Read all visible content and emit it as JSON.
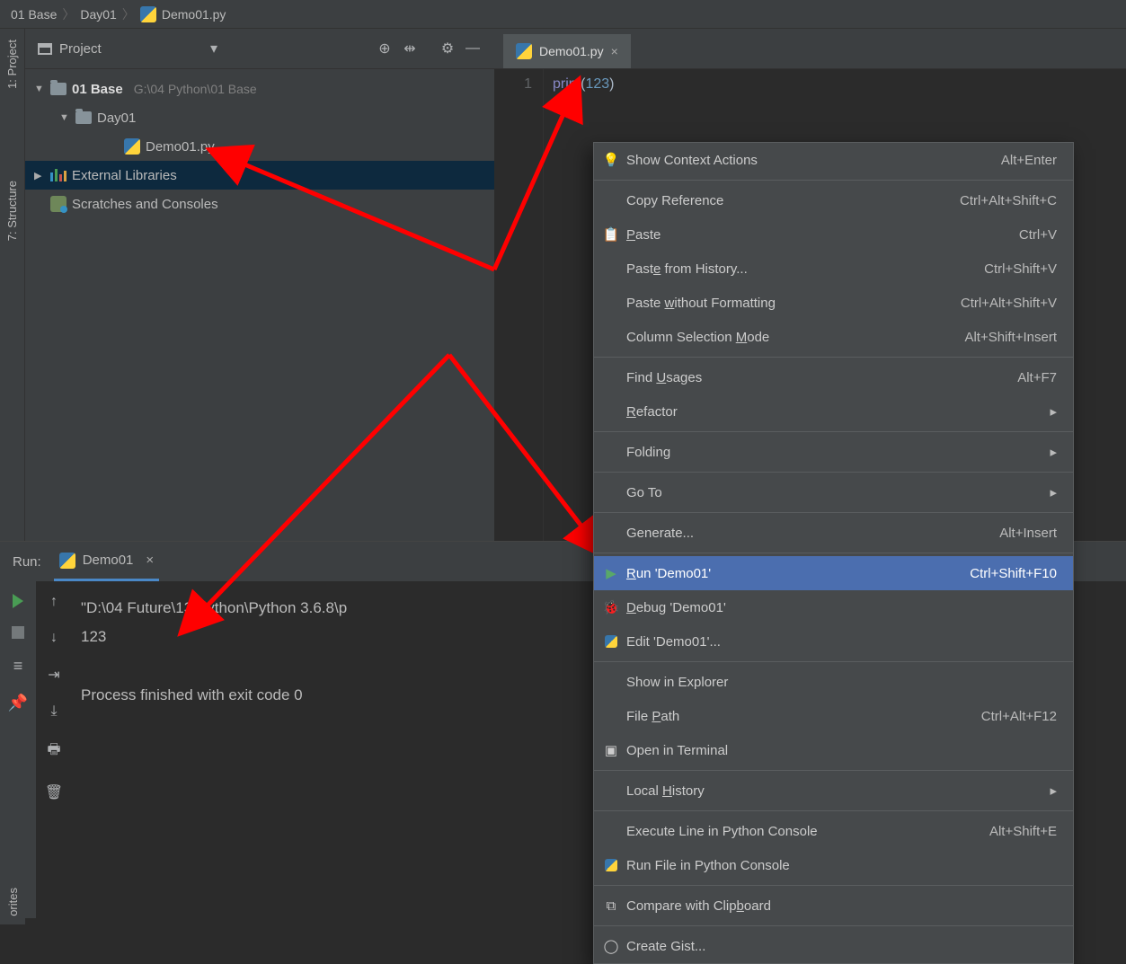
{
  "breadcrumb": {
    "root": "01 Base",
    "folder": "Day01",
    "file": "Demo01.py"
  },
  "sidebar": {
    "project_tab": "1: Project",
    "structure_tab": "7: Structure",
    "favorites_tab": "orites"
  },
  "project": {
    "title": "Project",
    "root": "01 Base",
    "root_path": "G:\\04 Python\\01 Base",
    "folder": "Day01",
    "file": "Demo01.py",
    "external": "External Libraries",
    "scratches": "Scratches and Consoles"
  },
  "editor": {
    "tab": "Demo01.py",
    "line_num": "1",
    "code_fn": "print",
    "code_p1": "(",
    "code_num": "123",
    "code_p2": ")"
  },
  "run": {
    "label": "Run:",
    "tab_name": "Demo01",
    "line1": "\"D:\\04 Future\\13 Python\\Python 3.6.8\\p",
    "line2": "123",
    "line3": "Process finished with exit code 0"
  },
  "menu": {
    "show_context": "Show Context Actions",
    "show_context_s": "Alt+Enter",
    "copy_ref": "Copy Reference",
    "copy_ref_s": "Ctrl+Alt+Shift+C",
    "paste": "Paste",
    "paste_s": "Ctrl+V",
    "paste_hist": "Paste from History...",
    "paste_hist_s": "Ctrl+Shift+V",
    "paste_nofmt": "Paste without Formatting",
    "paste_nofmt_s": "Ctrl+Alt+Shift+V",
    "col_sel": "Column Selection Mode",
    "col_sel_s": "Alt+Shift+Insert",
    "find_usages": "Find Usages",
    "find_usages_s": "Alt+F7",
    "refactor": "Refactor",
    "folding": "Folding",
    "goto": "Go To",
    "generate": "Generate...",
    "generate_s": "Alt+Insert",
    "run_item": "Run 'Demo01'",
    "run_item_s": "Ctrl+Shift+F10",
    "debug": "Debug 'Demo01'",
    "edit_conf": "Edit 'Demo01'...",
    "show_explorer": "Show in Explorer",
    "file_path": "File Path",
    "file_path_s": "Ctrl+Alt+F12",
    "open_term": "Open in Terminal",
    "local_hist": "Local History",
    "exec_line": "Execute Line in Python Console",
    "exec_line_s": "Alt+Shift+E",
    "run_console": "Run File in Python Console",
    "compare_clip": "Compare with Clipboard",
    "create_gist": "Create Gist..."
  }
}
